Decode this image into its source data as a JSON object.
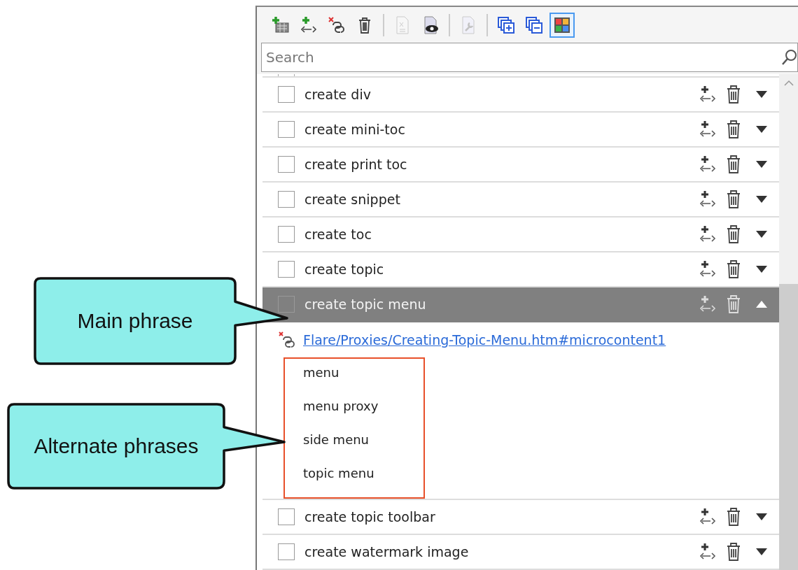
{
  "toolbar": [
    {
      "kind": "add-entry",
      "disabled": false,
      "selected": false
    },
    {
      "kind": "add-phrase",
      "disabled": false,
      "selected": false
    },
    {
      "kind": "unlink",
      "disabled": false,
      "selected": false
    },
    {
      "kind": "delete",
      "disabled": false,
      "selected": false
    },
    {
      "kind": "separator"
    },
    {
      "kind": "document",
      "disabled": true,
      "selected": false
    },
    {
      "kind": "preview",
      "disabled": false,
      "selected": false
    },
    {
      "kind": "separator"
    },
    {
      "kind": "properties",
      "disabled": true,
      "selected": false
    },
    {
      "kind": "separator"
    },
    {
      "kind": "expand-all",
      "disabled": false,
      "selected": false
    },
    {
      "kind": "collapse-all",
      "disabled": false,
      "selected": false
    },
    {
      "kind": "colors",
      "disabled": false,
      "selected": true
    }
  ],
  "search": {
    "placeholder": "Search"
  },
  "phrases": [
    {
      "text": "create div",
      "checked": false,
      "selected": false,
      "expanded": false
    },
    {
      "text": "create mini-toc",
      "checked": false,
      "selected": false,
      "expanded": false
    },
    {
      "text": "create print toc",
      "checked": false,
      "selected": false,
      "expanded": false
    },
    {
      "text": "create snippet",
      "checked": false,
      "selected": false,
      "expanded": false
    },
    {
      "text": "create toc",
      "checked": false,
      "selected": false,
      "expanded": false
    },
    {
      "text": "create topic",
      "checked": false,
      "selected": false,
      "expanded": false
    },
    {
      "text": "create topic menu",
      "checked": false,
      "selected": true,
      "expanded": true,
      "link": "Flare/Proxies/Creating-Topic-Menu.htm#microcontent1",
      "alternates": [
        "menu",
        "menu proxy",
        "side menu",
        "topic menu"
      ]
    },
    {
      "text": "create topic toolbar",
      "checked": false,
      "selected": false,
      "expanded": false
    },
    {
      "text": "create watermark image",
      "checked": false,
      "selected": false,
      "expanded": false
    }
  ],
  "callouts": [
    {
      "text": "Main phrase"
    },
    {
      "text": "Alternate phrases"
    }
  ]
}
